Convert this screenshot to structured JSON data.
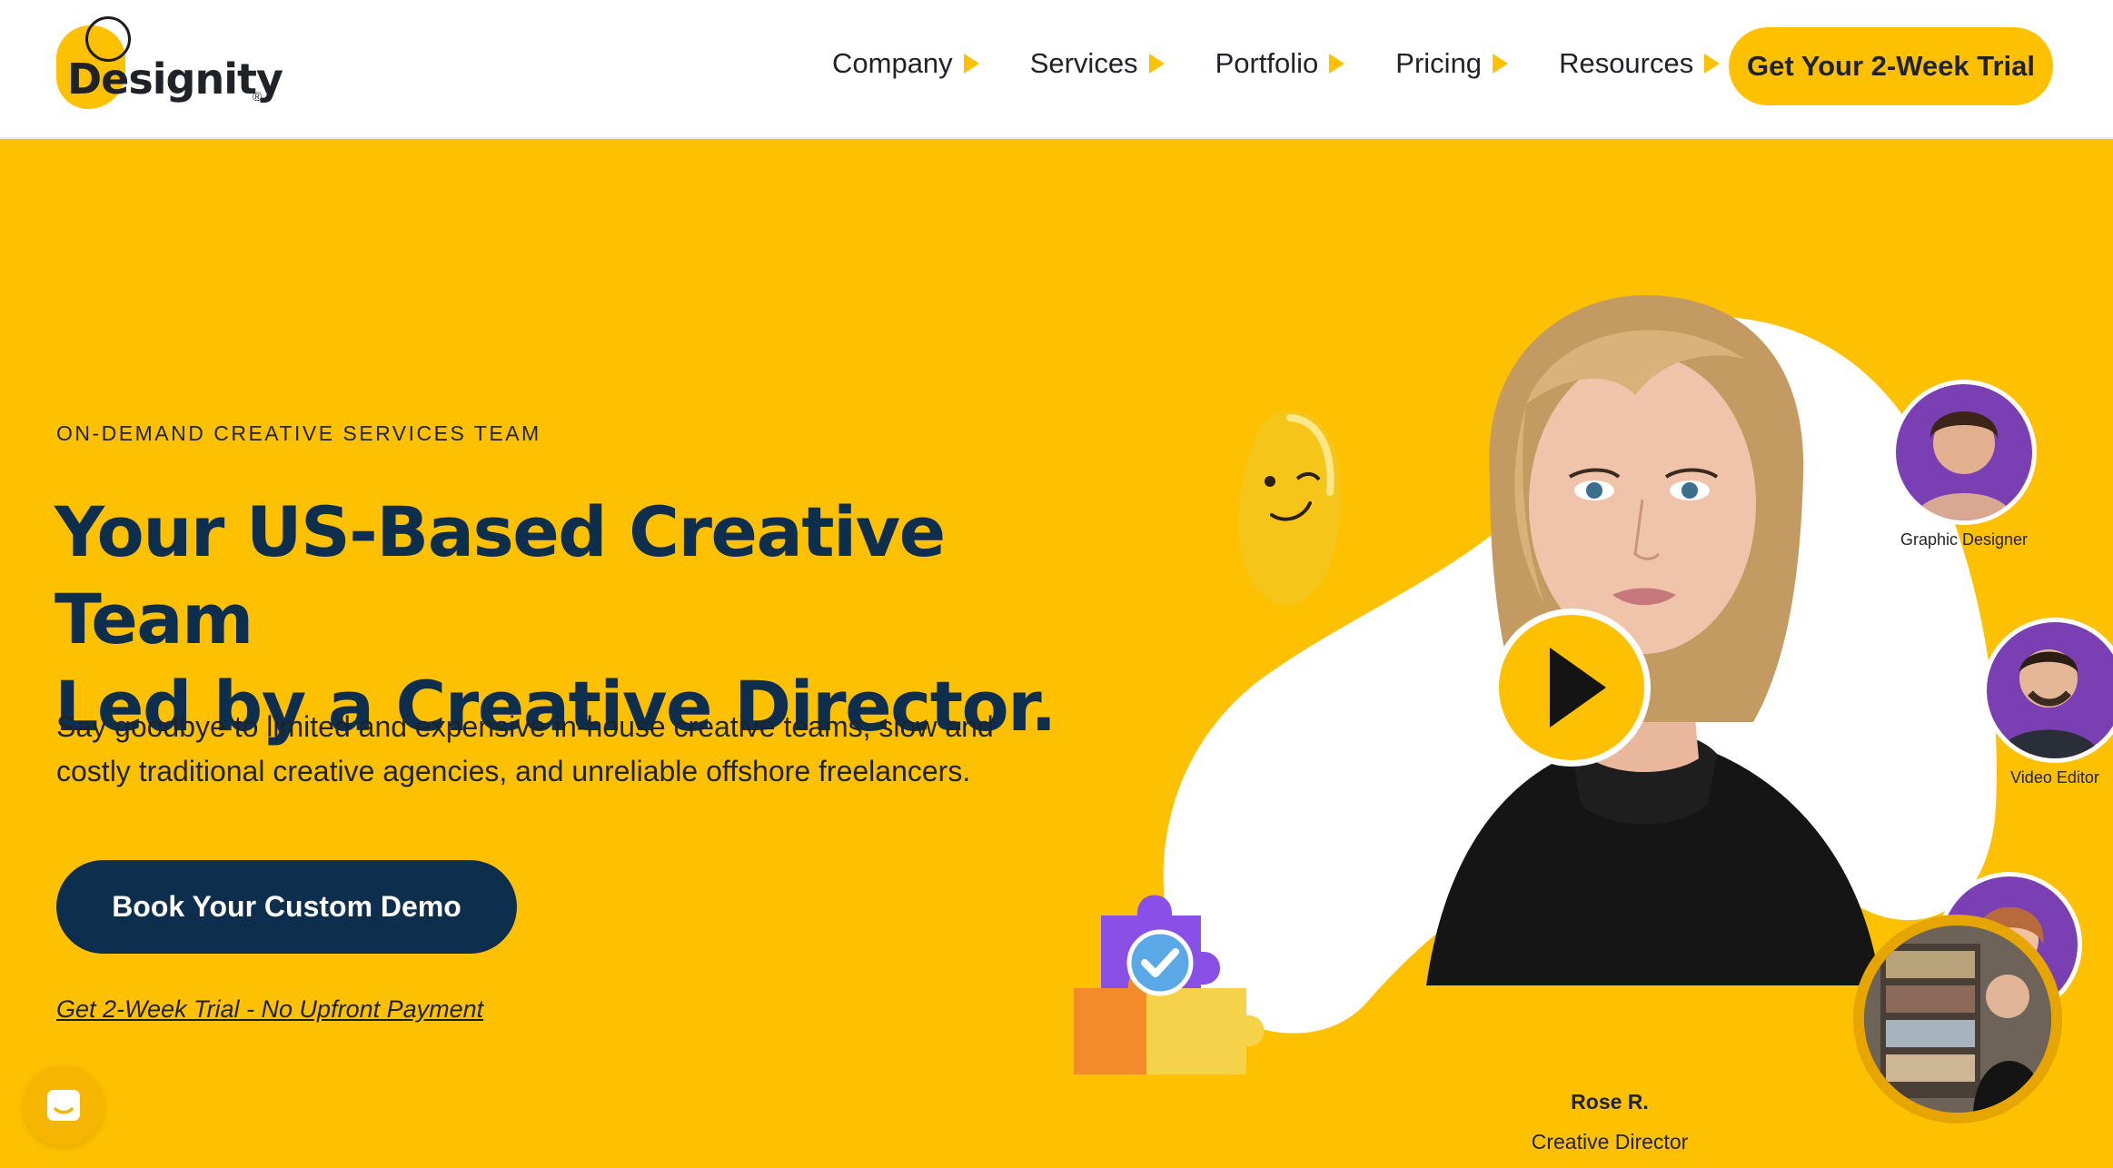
{
  "brand": {
    "name": "Designity",
    "reg": "®"
  },
  "nav": {
    "items": [
      {
        "label": "Company"
      },
      {
        "label": "Services"
      },
      {
        "label": "Portfolio"
      },
      {
        "label": "Pricing"
      },
      {
        "label": "Resources"
      }
    ],
    "cta": "Get Your 2-Week Trial"
  },
  "hero": {
    "eyebrow": "ON-DEMAND CREATIVE SERVICES TEAM",
    "headline_line1": "Your US-Based Creative Team",
    "headline_line2": "Led by a Creative Director.",
    "subtext": "Say goodbye to limited and expensive in-house creative teams, slow and costly traditional creative agencies, and unreliable offshore freelancers.",
    "demo_button": "Book Your Custom Demo",
    "trial_link": "Get 2-Week Trial - No Upfront Payment"
  },
  "team": {
    "featured_name": "Rose R.",
    "featured_role": "Creative Director",
    "members": [
      {
        "role": "Graphic Designer"
      },
      {
        "role": "Video Editor"
      }
    ]
  },
  "colors": {
    "brand_yellow": "#fdc101",
    "navy": "#0e2e4e",
    "text": "#1f2328",
    "avatar_purple": "#7b3fb4"
  },
  "icons": {
    "play": "play-icon",
    "menu_arrow": "triangle-right-icon",
    "chat": "chat-icon"
  }
}
